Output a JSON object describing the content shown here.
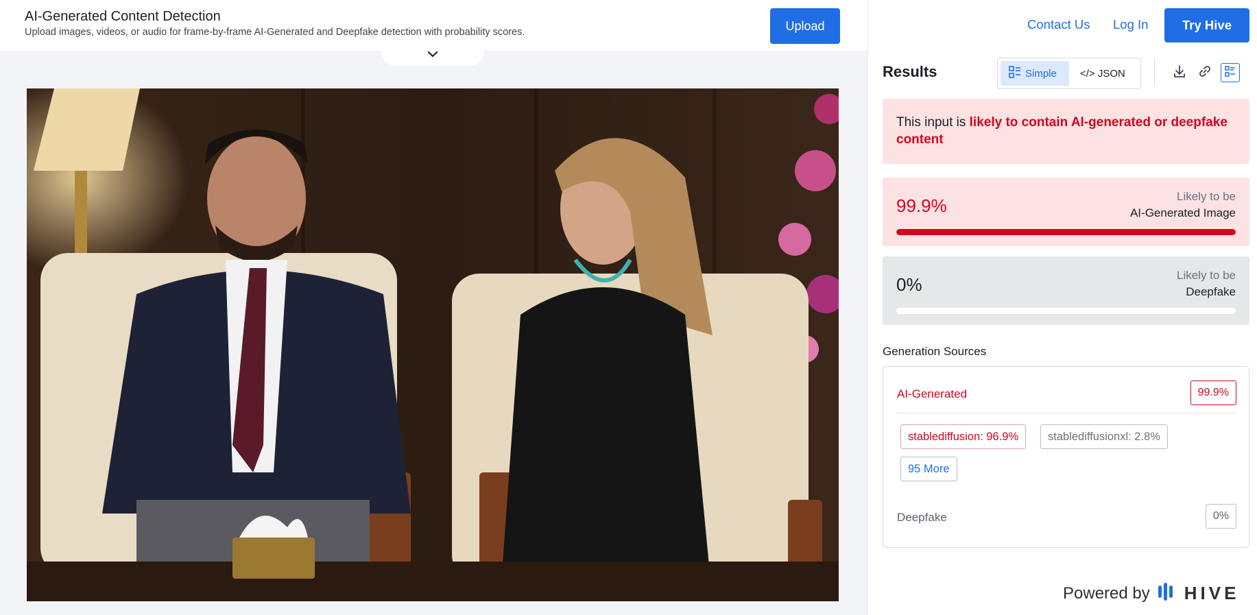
{
  "header": {
    "title": "AI-Generated Content Detection",
    "subtitle": "Upload images, videos, or audio for frame-by-frame AI-Generated and Deepfake detection with probability scores.",
    "upload_label": "Upload"
  },
  "nav": {
    "contact": "Contact Us",
    "login": "Log In",
    "try": "Try Hive"
  },
  "results": {
    "title": "Results",
    "view_simple": "Simple",
    "view_json": "</> JSON",
    "active_view": "Simple"
  },
  "verdict": {
    "prefix": "This input is ",
    "highlight": "likely to contain AI-generated or deepfake content"
  },
  "scores": [
    {
      "value": "99.9%",
      "label_top": "Likely to be",
      "label_bottom": "AI-Generated Image",
      "fraction": 0.999,
      "color": "#d2071e"
    },
    {
      "value": "0%",
      "label_top": "Likely to be",
      "label_bottom": "Deepfake",
      "fraction": 0.0,
      "color": "#1b1f24"
    }
  ],
  "generation": {
    "title": "Generation Sources",
    "ai_label": "AI-Generated",
    "ai_score": "99.9%",
    "sources": [
      "stablediffusion: 96.9%",
      "stablediffusionxl: 2.8%"
    ],
    "more": "95 More",
    "deepfake_label": "Deepfake",
    "deepfake_score": "0%"
  },
  "footer": {
    "powered_by": "Powered by",
    "brand": "HIVE"
  },
  "colors": {
    "accent": "#1f6ee6",
    "alert": "#d2071e",
    "alert_bg": "#fde2e4"
  },
  "icons": [
    "chevron-down-icon",
    "simple-view-icon",
    "download-icon",
    "link-icon",
    "list-view-icon",
    "hive-logo-icon"
  ]
}
